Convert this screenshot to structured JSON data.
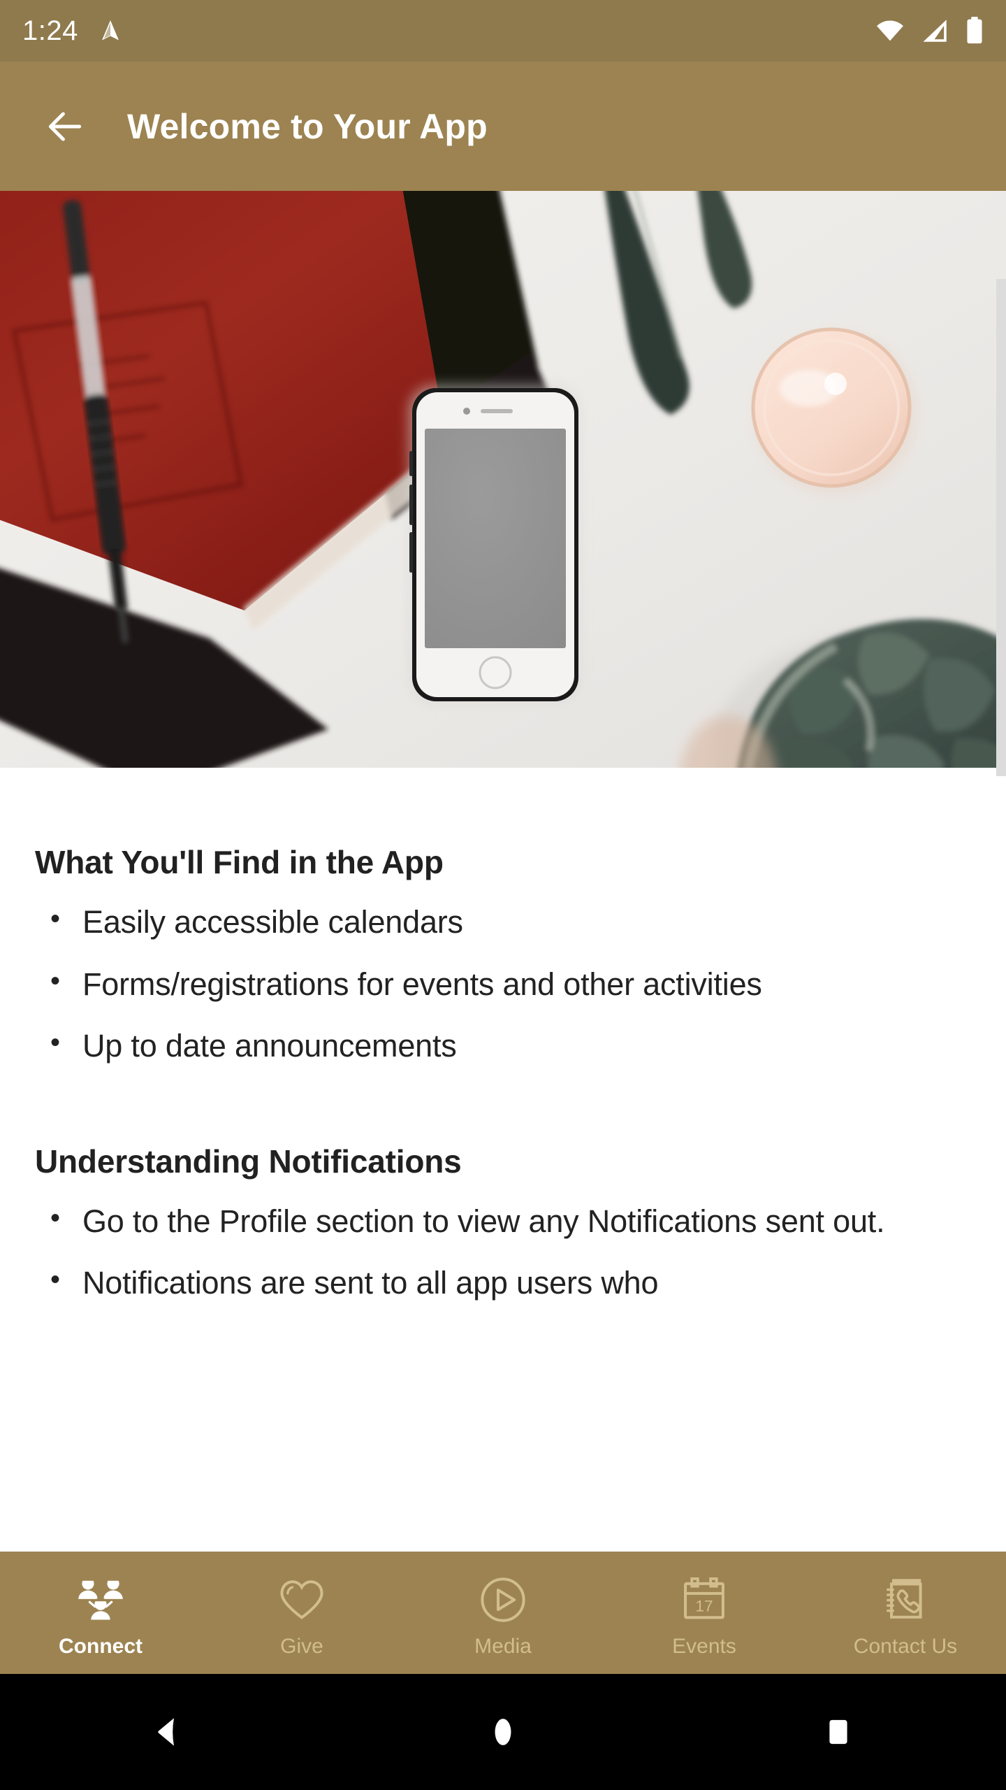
{
  "statusbar": {
    "time": "1:24",
    "icons": [
      "navigation-icon",
      "wifi-icon",
      "cellular-signal-icon",
      "battery-icon"
    ]
  },
  "toolbar": {
    "back_label": "back-arrow",
    "title": "Welcome to Your App"
  },
  "hero": {
    "alt": "Red notebook with pen, black notebook, smartphone, pink glass and succulent plant on white desk"
  },
  "content": {
    "sections": [
      {
        "heading": "What You'll Find in the App",
        "bullets": [
          "Easily accessible calendars",
          "Forms/registrations for events and other activities",
          "Up to date announcements"
        ]
      },
      {
        "heading": "Understanding Notifications",
        "bullets": [
          "Go to the Profile section to view any Notifications sent out.",
          "Notifications are sent to all app users who"
        ]
      }
    ]
  },
  "tabbar": {
    "items": [
      {
        "label": "Connect",
        "icon": "people-group-icon",
        "active": true
      },
      {
        "label": "Give",
        "icon": "heart-icon",
        "active": false
      },
      {
        "label": "Media",
        "icon": "play-circle-icon",
        "active": false
      },
      {
        "label": "Events",
        "icon": "calendar-icon",
        "active": false,
        "badge": "17"
      },
      {
        "label": "Contact Us",
        "icon": "address-book-icon",
        "active": false
      }
    ]
  },
  "navbar": {
    "back": "back-triangle-icon",
    "home": "home-circle-icon",
    "recents": "recents-square-icon"
  },
  "colors": {
    "statusbar": "#8f7a4d",
    "toolbar": "#9c8351",
    "tabbar": "#9c8351",
    "tab_active": "#ffffff",
    "tab_inactive": "#d2bd8e",
    "text": "#222222",
    "scrollbar": "#dcdcdc"
  }
}
